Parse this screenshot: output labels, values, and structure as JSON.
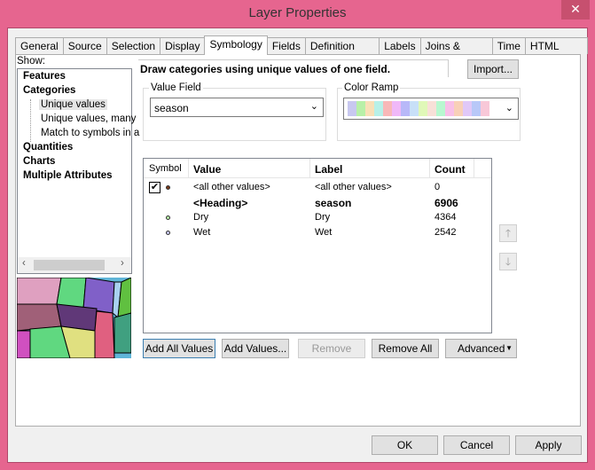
{
  "window": {
    "title": "Layer Properties",
    "close": "✕"
  },
  "tabs": [
    "General",
    "Source",
    "Selection",
    "Display",
    "Symbology",
    "Fields",
    "Definition Query",
    "Labels",
    "Joins & Relates",
    "Time",
    "HTML Popup"
  ],
  "show_label": "Show:",
  "tree": {
    "features": "Features",
    "categories": "Categories",
    "unique_values": "Unique values",
    "unique_many": "Unique values, many",
    "match": "Match to symbols in a",
    "quantities": "Quantities",
    "charts": "Charts",
    "multiple": "Multiple Attributes"
  },
  "description": "Draw categories using unique values of one field.",
  "import_label": "Import...",
  "value_field": {
    "label": "Value Field",
    "value": "season"
  },
  "color_ramp": {
    "label": "Color Ramp",
    "colors": [
      "#c8c8f0",
      "#b8f0a8",
      "#f8e0b8",
      "#b8f0e8",
      "#f8b8b8",
      "#f0b8f8",
      "#b8b8f8",
      "#c8e0f8",
      "#e0f8b8",
      "#f8e0d8",
      "#b8f8d0",
      "#f8c0e8",
      "#f8d0b8",
      "#e0c8f8",
      "#b8c8f8",
      "#f8c8d8"
    ]
  },
  "table": {
    "headers": {
      "symbol": "Symbol",
      "value": "Value",
      "label": "Label",
      "count": "Count"
    },
    "rows": [
      {
        "value": "<all other values>",
        "label": "<all other values>",
        "count": "0",
        "color": "#7a3a1a",
        "bold": false,
        "check": true
      },
      {
        "value": "<Heading>",
        "label": "season",
        "count": "6906",
        "bold": true
      },
      {
        "value": "Dry",
        "label": "Dry",
        "count": "4364",
        "color": "#b8f0a8",
        "bold": false
      },
      {
        "value": "Wet",
        "label": "Wet",
        "count": "2542",
        "color": "#c8c8f0",
        "bold": false
      }
    ]
  },
  "buttons": {
    "add_all": "Add All Values",
    "add": "Add Values...",
    "remove": "Remove",
    "remove_all": "Remove All",
    "advanced": "Advanced"
  },
  "footer": {
    "ok": "OK",
    "cancel": "Cancel",
    "apply": "Apply"
  }
}
